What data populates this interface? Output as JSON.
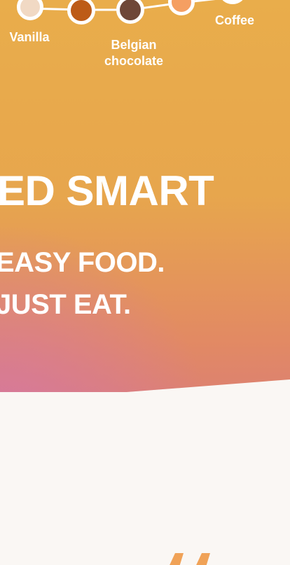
{
  "flavors": [
    {
      "label": "Vanilla",
      "color": "#f1d9c4"
    },
    {
      "label": "",
      "color": "#bd5b17"
    },
    {
      "label": "Belgian chocolate",
      "label_line1": "Belgian",
      "label_line2": "chocolate",
      "color": "#6e4738"
    },
    {
      "label": "",
      "color": "#f59f62"
    },
    {
      "label": "Coffee",
      "color": "#ffffff"
    }
  ],
  "hero": {
    "headline": "ED SMART",
    "tagline_line1": "EASY FOOD.",
    "tagline_line2": "JUST EAT."
  },
  "colors": {
    "hero_top": "#e9ad4b",
    "hero_bottom_left": "#d5789f",
    "background": "#faf7f4",
    "accent_quote": "#f0a257"
  },
  "icons": {
    "quote": "quote-marks-icon"
  }
}
